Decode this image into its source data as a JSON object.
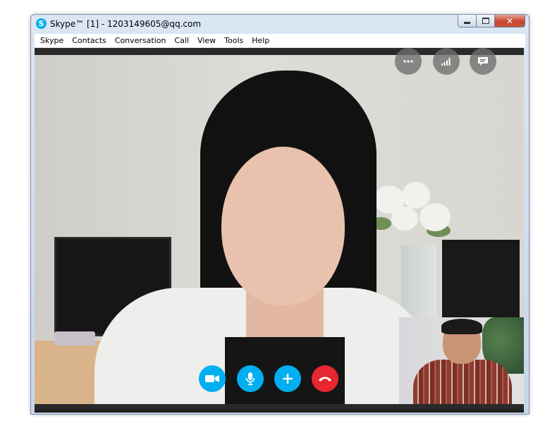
{
  "window": {
    "title": "Skype™ [1] - 1203149605@qq.com",
    "app_icon_letter": "S",
    "controls": {
      "close_glyph": "✕"
    }
  },
  "menu": [
    "Skype",
    "Contacts",
    "Conversation",
    "Call",
    "View",
    "Tools",
    "Help"
  ],
  "overlay_controls": [
    {
      "name": "more-options",
      "icon": "ellipsis-icon"
    },
    {
      "name": "call-quality",
      "icon": "signal-bars-icon"
    },
    {
      "name": "show-chat",
      "icon": "chat-bubble-icon"
    }
  ],
  "call_controls": [
    {
      "name": "video-toggle",
      "icon": "video-camera-icon"
    },
    {
      "name": "mute-toggle",
      "icon": "microphone-icon"
    },
    {
      "name": "add-participant",
      "icon": "plus-icon"
    },
    {
      "name": "end-call",
      "icon": "hang-up-icon"
    }
  ],
  "colors": {
    "skype_blue": "#00aff0",
    "end_call_red": "#e7262f",
    "overlay_gray": "#6e6e6e"
  }
}
